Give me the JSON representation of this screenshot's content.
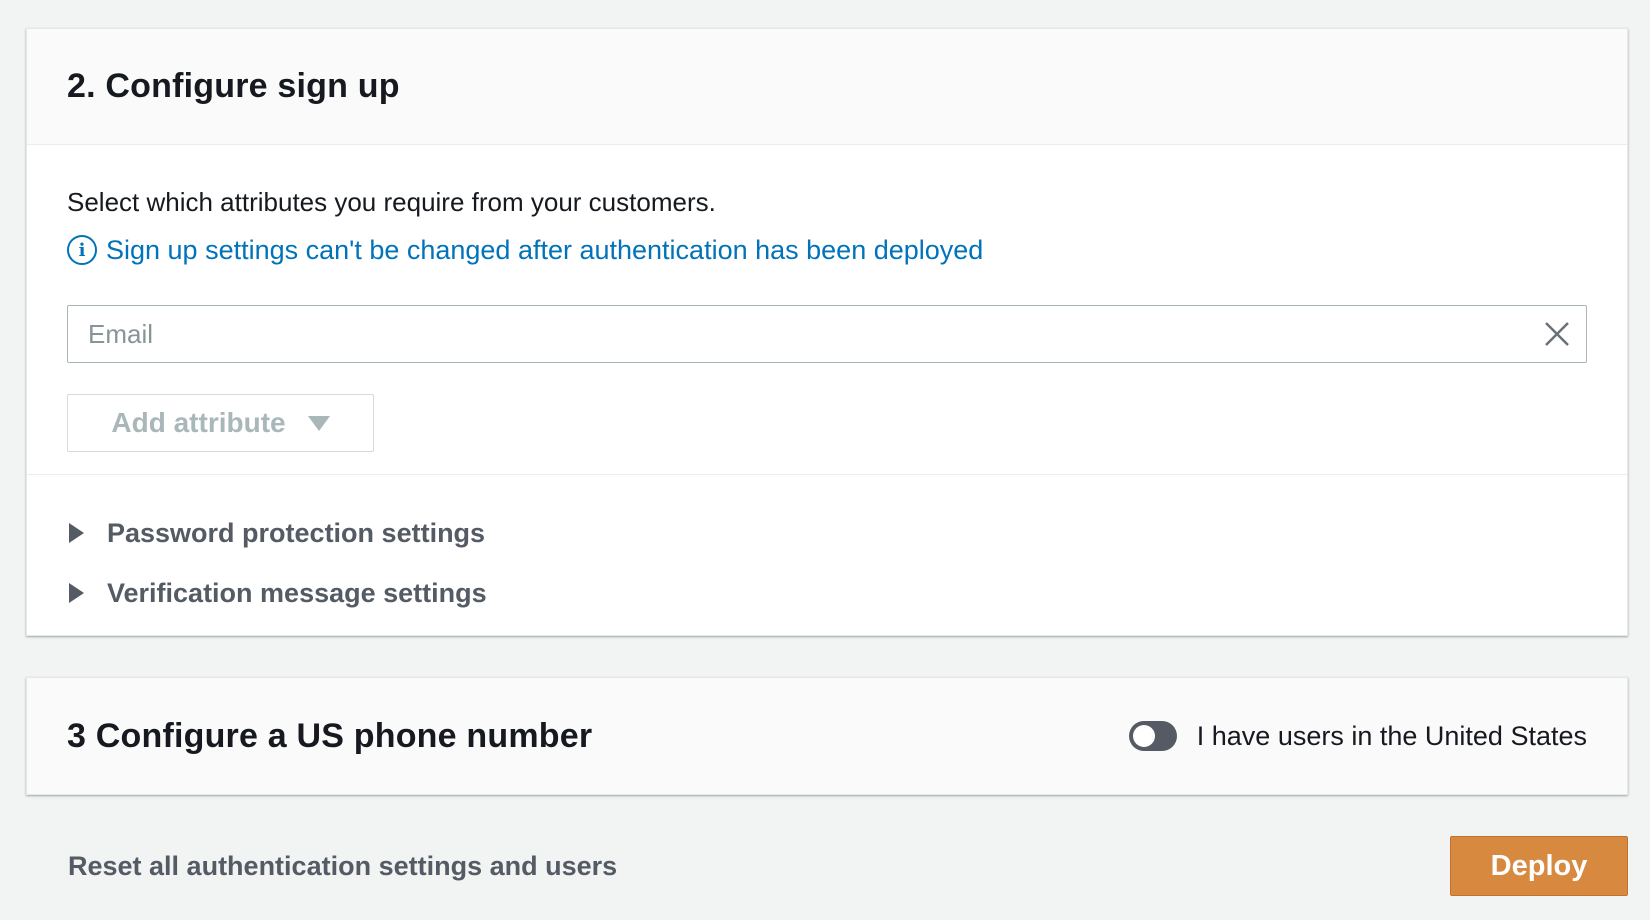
{
  "signup": {
    "title": "2. Configure sign up",
    "description": "Select which attributes you require from your customers.",
    "info_text": "Sign up settings can't be changed after authentication has been deployed",
    "attribute_value": "Email",
    "add_attribute_label": "Add attribute",
    "expanders": [
      {
        "label": "Password protection settings"
      },
      {
        "label": "Verification message settings"
      }
    ]
  },
  "phone": {
    "title": "3 Configure a US phone number",
    "toggle_label": "I have users in the United States",
    "toggle_on": false
  },
  "footer": {
    "reset_label": "Reset all authentication settings and users",
    "deploy_label": "Deploy"
  },
  "colors": {
    "accent_link": "#0073bb",
    "deploy_button": "#d88940",
    "toggle_off": "#545b64"
  }
}
